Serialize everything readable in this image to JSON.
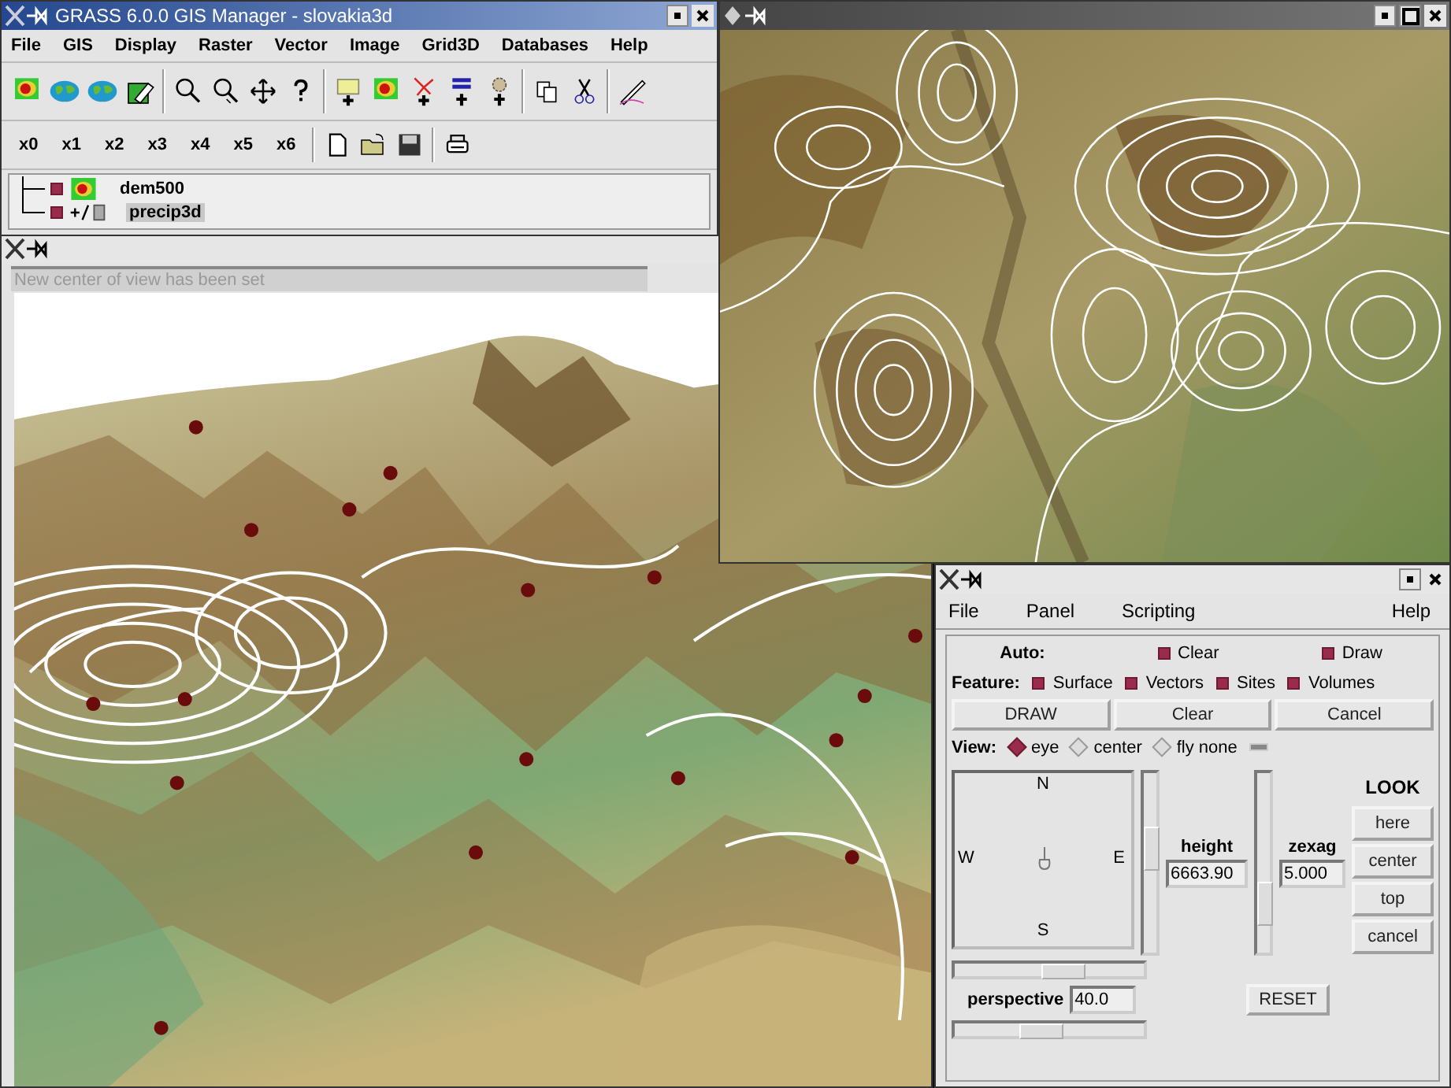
{
  "gis_manager": {
    "title": "GRASS 6.0.0 GIS Manager - slovakia3d",
    "menu": [
      "File",
      "GIS",
      "Display",
      "Raster",
      "Vector",
      "Image",
      "Grid3D",
      "Databases",
      "Help"
    ],
    "monitor_buttons": [
      "x0",
      "x1",
      "x2",
      "x3",
      "x4",
      "x5",
      "x6"
    ],
    "layers": [
      {
        "name": "dem500",
        "kind": "raster",
        "checked": true,
        "selected": false
      },
      {
        "name": "precip3d",
        "kind": "volume",
        "checked": true,
        "selected": true
      }
    ]
  },
  "nviz": {
    "status": "New center of view has been set"
  },
  "controls": {
    "menu": [
      "File",
      "Panel",
      "Scripting",
      "Help"
    ],
    "auto": {
      "label": "Auto:",
      "options": [
        {
          "label": "Clear",
          "checked": true
        },
        {
          "label": "Draw",
          "checked": true
        }
      ]
    },
    "feature": {
      "label": "Feature:",
      "options": [
        {
          "label": "Surface",
          "checked": true
        },
        {
          "label": "Vectors",
          "checked": true
        },
        {
          "label": "Sites",
          "checked": true
        },
        {
          "label": "Volumes",
          "checked": true
        }
      ]
    },
    "buttons": [
      "DRAW",
      "Clear",
      "Cancel"
    ],
    "view": {
      "label": "View:",
      "modes": [
        {
          "label": "eye",
          "selected": true
        },
        {
          "label": "center",
          "selected": false
        },
        {
          "label": "fly none",
          "selected": false
        }
      ]
    },
    "compass": {
      "north": "N",
      "east": "E",
      "south": "S",
      "west": "W"
    },
    "position_slider": {
      "level": 0.6
    },
    "height": {
      "label": "height",
      "value": "6663.90"
    },
    "zexag": {
      "label": "zexag",
      "value": "5.000",
      "level": 0.2
    },
    "look": {
      "label": "LOOK",
      "buttons": [
        "here",
        "center",
        "top",
        "cancel"
      ]
    },
    "perspective": {
      "label": "perspective",
      "value": "40.0",
      "level": 0.6
    },
    "twist_slider": {
      "level": 0.45
    },
    "reset": "RESET"
  }
}
